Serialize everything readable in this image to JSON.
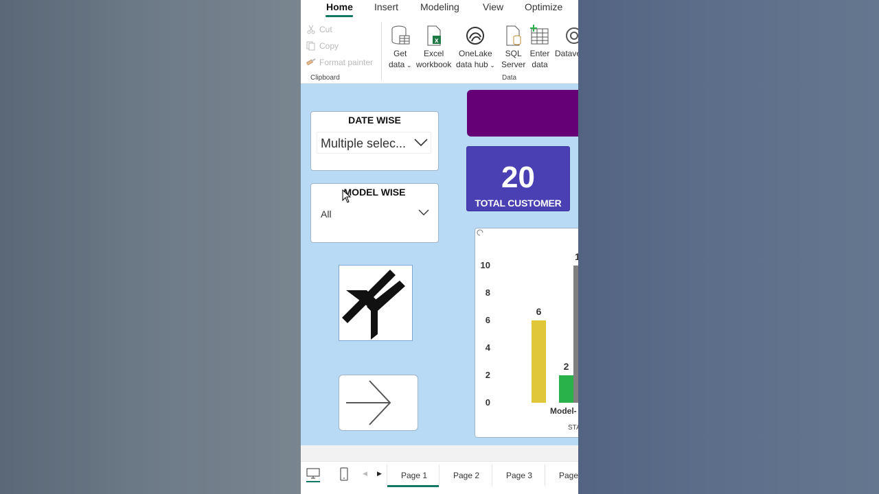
{
  "ribbon": {
    "tabs": [
      "Home",
      "Insert",
      "Modeling",
      "View",
      "Optimize"
    ],
    "active_tab": "Home",
    "clipboard": {
      "items": [
        "Cut",
        "Copy",
        "Format painter"
      ],
      "group_label": "Clipboard"
    },
    "data": {
      "buttons": [
        {
          "line1": "Get",
          "line2": "data"
        },
        {
          "line1": "Excel",
          "line2": "workbook"
        },
        {
          "line1": "OneLake",
          "line2": "data hub"
        },
        {
          "line1": "SQL",
          "line2": "Server"
        },
        {
          "line1": "Enter",
          "line2": "data"
        },
        {
          "line1": "Datave",
          "line2": ""
        }
      ],
      "group_label": "Data"
    }
  },
  "canvas": {
    "background": "#b9daf5",
    "date_slicer": {
      "title": "DATE WISE",
      "value": "Multiple selec..."
    },
    "model_slicer": {
      "title": "MODEL WISE",
      "value": "All"
    },
    "banner_color": "#660077",
    "kpi": {
      "value": "20",
      "label": "TOTAL CUSTOMER",
      "color": "#4a3fb3"
    },
    "icons": {
      "logo": "logo-icon",
      "arrow": "arrow-right-icon"
    }
  },
  "chart_data": {
    "type": "bar",
    "categories": [
      "",
      "",
      ""
    ],
    "values": [
      6,
      2,
      10
    ],
    "colors": [
      "#e0c73a",
      "#2ab24a",
      "#808080"
    ],
    "y_ticks": [
      0,
      2,
      4,
      6,
      8,
      10
    ],
    "ylim": [
      0,
      10
    ],
    "xlabel_visible": "Model-",
    "axis_title_visible": "STA",
    "cut_data_label": "1",
    "grid": false
  },
  "pages": {
    "tabs": [
      "Page 1",
      "Page 2",
      "Page 3",
      "Page"
    ],
    "active": "Page 1"
  }
}
